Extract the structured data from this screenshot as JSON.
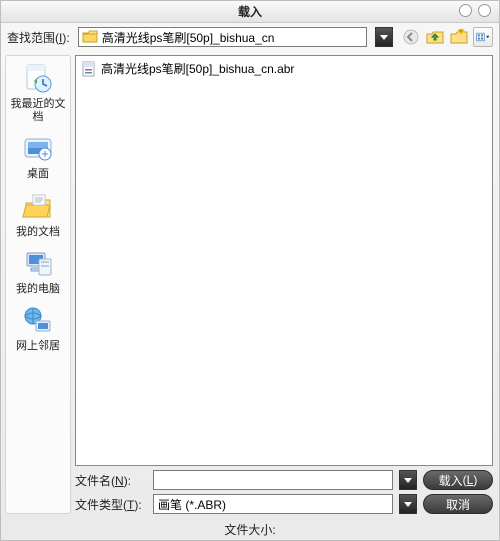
{
  "title": "载入",
  "look_in_label": "查找范围",
  "look_in_hotkey": "I",
  "current_path": "高清光线ps笔刷[50p]_bishua_cn",
  "sidebar": [
    {
      "key": "recent",
      "label": "我最近的文档"
    },
    {
      "key": "desktop",
      "label": "桌面"
    },
    {
      "key": "mydocs",
      "label": "我的文档"
    },
    {
      "key": "mypc",
      "label": "我的电脑"
    },
    {
      "key": "network",
      "label": "网上邻居"
    }
  ],
  "files": [
    {
      "name": "高清光线ps笔刷[50p]_bishua_cn.abr",
      "icon": "abr"
    }
  ],
  "filename_label": "文件名",
  "filename_hotkey": "N",
  "filename_value": "",
  "filetype_label": "文件类型",
  "filetype_hotkey": "T",
  "filetype_value": "画笔 (*.ABR)",
  "load_button": "载入",
  "load_hotkey": "L",
  "cancel_button": "取消",
  "filesize_label": "文件大小:"
}
